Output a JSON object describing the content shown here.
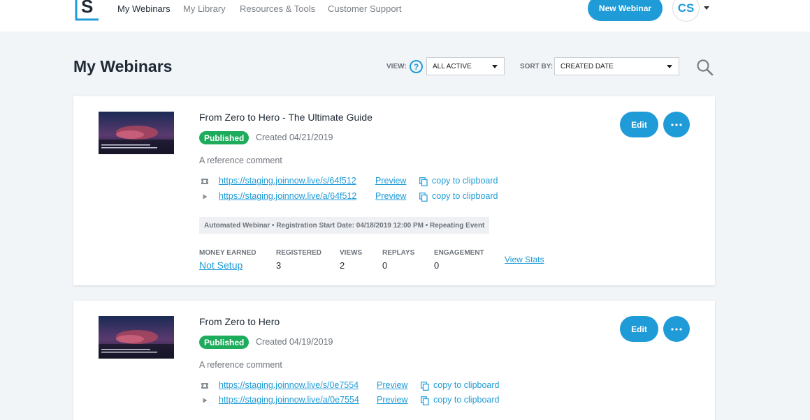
{
  "nav": {
    "items": [
      "My Webinars",
      "My Library",
      "Resources & Tools",
      "Customer Support"
    ],
    "new_button": "New Webinar",
    "avatar_initials": "CS"
  },
  "page": {
    "title": "My Webinars",
    "view_label": "VIEW:",
    "view_value": "ALL ACTIVE",
    "sort_label": "SORT BY:",
    "sort_value": "CREATED DATE"
  },
  "icons": {
    "logo": "logo-s-icon",
    "help": "question-circle-icon",
    "search": "search-icon",
    "ticket": "ticket-icon",
    "play": "play-icon",
    "copy": "copy-icon",
    "more": "ellipsis-icon"
  },
  "colors": {
    "accent": "#1f9bd7",
    "published": "#1dab5c",
    "background": "#f2f5f8"
  },
  "webinars": [
    {
      "title": "From Zero to Hero - The Ultimate Guide",
      "status": "Published",
      "created": "Created 04/21/2019",
      "comment": "A reference comment",
      "registration_url": "https://staging.joinnow.live/s/64f512",
      "attendee_url": "https://staging.joinnow.live/a/64f512",
      "preview_label": "Preview",
      "copy_label": "copy to clipboard",
      "info": "Automated Webinar • Registration Start Date: 04/18/2019 12:00 PM • Repeating Event",
      "stats": {
        "money_label": "MONEY EARNED",
        "money_value": "Not Setup",
        "registered_label": "REGISTERED",
        "registered_value": "3",
        "views_label": "VIEWS",
        "views_value": "2",
        "replays_label": "REPLAYS",
        "replays_value": "0",
        "engagement_label": "ENGAGEMENT",
        "engagement_value": "0",
        "view_stats": "View Stats"
      },
      "edit_label": "Edit"
    },
    {
      "title": "From Zero to Hero",
      "status": "Published",
      "created": "Created 04/19/2019",
      "comment": "A reference comment",
      "registration_url": "https://staging.joinnow.live/s/0e7554",
      "attendee_url": "https://staging.joinnow.live/a/0e7554",
      "preview_label": "Preview",
      "copy_label": "copy to clipboard",
      "edit_label": "Edit"
    }
  ]
}
